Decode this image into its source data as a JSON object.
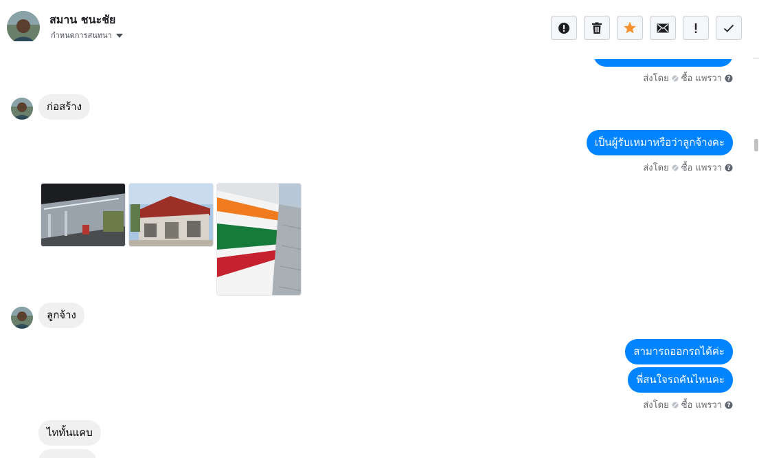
{
  "header": {
    "contact_name": "สมาน ชนะชัย",
    "conversation_menu_label": "กำหนดการสนทนา",
    "actions": [
      {
        "name": "report-spam",
        "icon": "alert-circle-icon"
      },
      {
        "name": "delete",
        "icon": "trash-icon"
      },
      {
        "name": "star",
        "icon": "star-icon",
        "color": "#f5922f"
      },
      {
        "name": "mark-unread",
        "icon": "envelope-icon"
      },
      {
        "name": "follow-up",
        "icon": "exclamation-icon"
      },
      {
        "name": "mark-done",
        "icon": "check-icon"
      }
    ]
  },
  "messages": {
    "sent_by_1": "ส่งโดย",
    "sender_1": "ซื้อ แพรวา",
    "in_1": "ก่อสร้าง",
    "out_1": "เป็นผู้รับเหมาหรือว่าลูกจ้างคะ",
    "sent_by_2": "ส่งโดย",
    "sender_2": "ซื้อ แพรวา",
    "photos": [
      "photo-store-night",
      "photo-building-construction",
      "photo-seven-eleven-sign"
    ],
    "in_2": "ลูกจ้าง",
    "out_2": "สามารถออกรถได้ค่ะ",
    "out_3": "พี่สนใจรถคันไหนคะ",
    "sent_by_3": "ส่งโดย",
    "sender_3": "ซื้อ แพรวา",
    "in_3": "ไททั้นแคบ"
  },
  "colors": {
    "outgoing_bubble": "#0084ff",
    "incoming_bubble": "#f0f0f0",
    "star": "#f5922f"
  }
}
